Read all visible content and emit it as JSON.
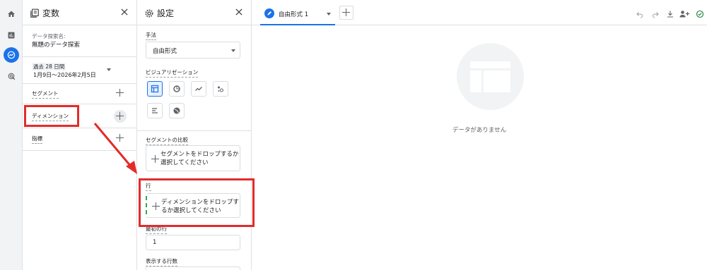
{
  "colors": {
    "accent": "#1a73e8",
    "annotation": "#e32b2b",
    "drop_hint": "#34a853"
  },
  "rail": {
    "items": [
      {
        "icon": "home-icon"
      },
      {
        "icon": "bar-chart-icon"
      },
      {
        "icon": "explore-icon",
        "active": true
      },
      {
        "icon": "advertising-icon"
      }
    ]
  },
  "variables": {
    "title": "変数",
    "exploration_name_label": "データ探索名:",
    "exploration_name": "無題のデータ探索",
    "date_range_label": "過去 28 日間",
    "date_range": "1月9日〜2026年2月5日",
    "segments_label": "セグメント",
    "dimensions_label": "ディメンション",
    "metrics_label": "指標"
  },
  "settings": {
    "title": "設定",
    "technique_label": "手法",
    "technique_value": "自由形式",
    "visualization_label": "ビジュアリゼーション",
    "visualization_options": [
      "table-icon",
      "donut-chart-icon",
      "line-chart-icon",
      "scatter-icon",
      "bar-chart-icon",
      "geo-map-icon"
    ],
    "segment_compare_label": "セグメントの比較",
    "segment_drop_text": "セグメントをドロップするか選択してください",
    "rows_label": "行",
    "rows_drop_text": "ディメンションをドロップするか選択してください",
    "first_row_label": "最初の行",
    "first_row_value": "1",
    "show_rows_label": "表示する行数"
  },
  "canvas": {
    "tab_label": "自由形式 1",
    "toolbar": [
      "undo-icon",
      "redo-icon",
      "download-icon",
      "share-icon",
      "check-circle-icon"
    ],
    "empty_text": "データがありません"
  }
}
